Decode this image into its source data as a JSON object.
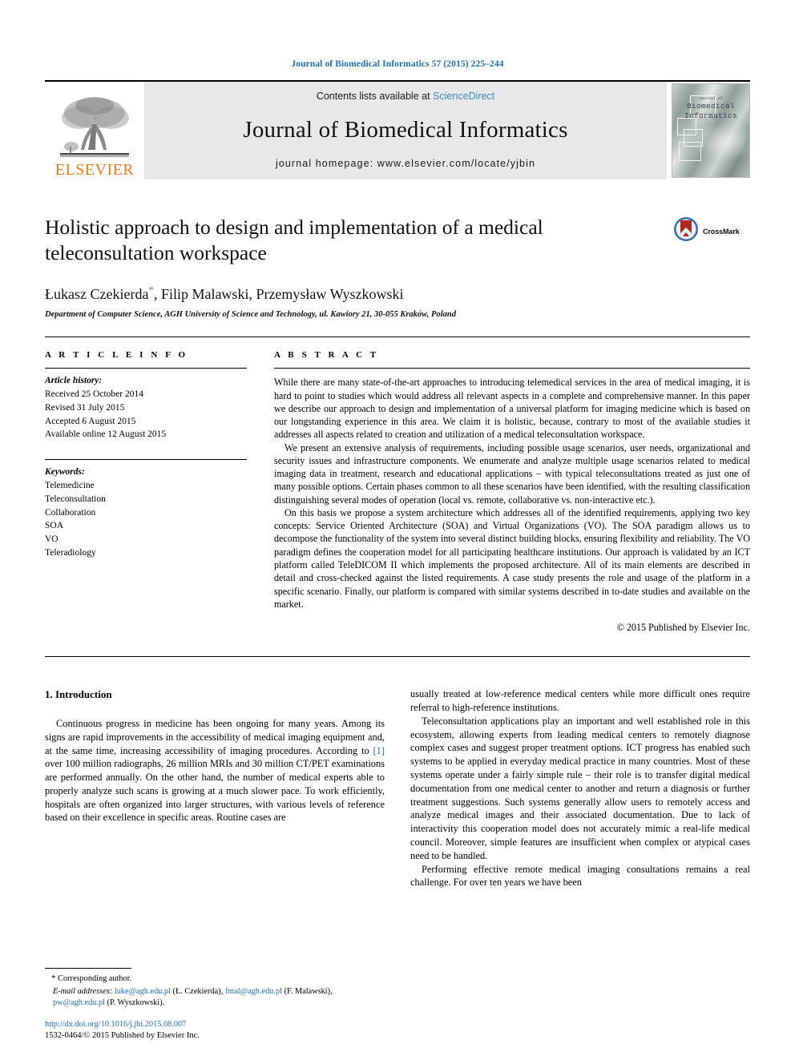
{
  "running_head": "Journal of Biomedical Informatics 57 (2015) 225–244",
  "banner": {
    "publisher_name": "ELSEVIER",
    "contents_prefix": "Contents lists available at",
    "contents_link": "ScienceDirect",
    "journal_title": "Journal of Biomedical Informatics",
    "homepage": "journal homepage: www.elsevier.com/locate/yjbin",
    "cover_line1": "Journal of",
    "cover_line2": "Biomedical",
    "cover_line3": "Informatics"
  },
  "article": {
    "title": "Holistic approach to design and implementation of a medical teleconsultation workspace",
    "authors": "Łukasz Czekierda",
    "authors_rest": ", Filip Malawski, Przemysław Wyszkowski",
    "corresponding_marker": "*",
    "affiliation": "Department of Computer Science, AGH University of Science and Technology, ul. Kawiory 21, 30-055 Kraków, Poland",
    "crossmark_label": "CrossMark"
  },
  "info": {
    "heading": "A R T I C L E   I N F O",
    "history_label": "Article history:",
    "history": [
      "Received 25 October 2014",
      "Revised 31 July 2015",
      "Accepted 6 August 2015",
      "Available online 12 August 2015"
    ],
    "keywords_label": "Keywords:",
    "keywords": [
      "Telemedicine",
      "Teleconsultation",
      "Collaboration",
      "SOA",
      "VO",
      "Teleradiology"
    ]
  },
  "abstract": {
    "heading": "A B S T R A C T",
    "paragraphs": [
      "While there are many state-of-the-art approaches to introducing telemedical services in the area of medical imaging, it is hard to point to studies which would address all relevant aspects in a complete and comprehensive manner. In this paper we describe our approach to design and implementation of a universal platform for imaging medicine which is based on our longstanding experience in this area. We claim it is holistic, because, contrary to most of the available studies it addresses all aspects related to creation and utilization of a medical teleconsultation workspace.",
      "We present an extensive analysis of requirements, including possible usage scenarios, user needs, organizational and security issues and infrastructure components. We enumerate and analyze multiple usage scenarios related to medical imaging data in treatment, research and educational applications – with typical teleconsultations treated as just one of many possible options. Certain phases common to all these scenarios have been identified, with the resulting classification distinguishing several modes of operation (local vs. remote, collaborative vs. non-interactive etc.).",
      "On this basis we propose a system architecture which addresses all of the identified requirements, applying two key concepts: Service Oriented Architecture (SOA) and Virtual Organizations (VO). The SOA paradigm allows us to decompose the functionality of the system into several distinct building blocks, ensuring flexibility and reliability. The VO paradigm defines the cooperation model for all participating healthcare institutions. Our approach is validated by an ICT platform called TeleDICOM II which implements the proposed architecture. All of its main elements are described in detail and cross-checked against the listed requirements. A case study presents the role and usage of the platform in a specific scenario. Finally, our platform is compared with similar systems described in to-date studies and available on the market."
    ],
    "copyright": "© 2015 Published by Elsevier Inc."
  },
  "body": {
    "section_heading": "1. Introduction",
    "left_paragraphs": [
      "Continuous progress in medicine has been ongoing for many years. Among its signs are rapid improvements in the accessibility of medical imaging equipment and, at the same time, increasing accessibility of imaging procedures. According to [1] over 100 million radiographs, 26 million MRIs and 30 million CT/PET examinations are performed annually. On the other hand, the number of medical experts able to properly analyze such scans is growing at a much slower pace. To work efficiently, hospitals are often organized into larger structures, with various levels of reference based on their excellence in specific areas. Routine cases are"
    ],
    "reference_marker": "[1]",
    "right_paragraphs": [
      "usually treated at low-reference medical centers while more difficult ones require referral to high-reference institutions.",
      "Teleconsultation applications play an important and well established role in this ecosystem, allowing experts from leading medical centers to remotely diagnose complex cases and suggest proper treatment options. ICT progress has enabled such systems to be applied in everyday medical practice in many countries. Most of these systems operate under a fairly simple rule – their role is to transfer digital medical documentation from one medical center to another and return a diagnosis or further treatment suggestions. Such systems generally allow users to remotely access and analyze medical images and their associated documentation. Due to lack of interactivity this cooperation model does not accurately mimic a real-life medical council. Moreover, simple features are insufficient when complex or atypical cases need to be handled.",
      "Performing effective remote medical imaging consultations remains a real challenge. For over ten years we have been"
    ]
  },
  "footnote": {
    "corresponding": "Corresponding author.",
    "email_label": "E-mail addresses:",
    "emails": [
      {
        "address": "luke@agh.edu.pl",
        "owner": "(Ł. Czekierda)"
      },
      {
        "address": "fmal@agh.edu.pl",
        "owner": "(F. Malawski)"
      },
      {
        "address": "pw@agh.edu.pl",
        "owner": "(P. Wyszkowski)"
      }
    ],
    "doi": "http://dx.doi.org/10.1016/j.jbi.2015.08.007",
    "issn_line": "1532-0464/© 2015 Published by Elsevier Inc."
  },
  "colors": {
    "link_blue": "#1a6fb5",
    "sciencedirect_blue": "#3a8fc4",
    "elsevier_orange": "#ef7d1a",
    "banner_gray": "#e8e8e8"
  }
}
